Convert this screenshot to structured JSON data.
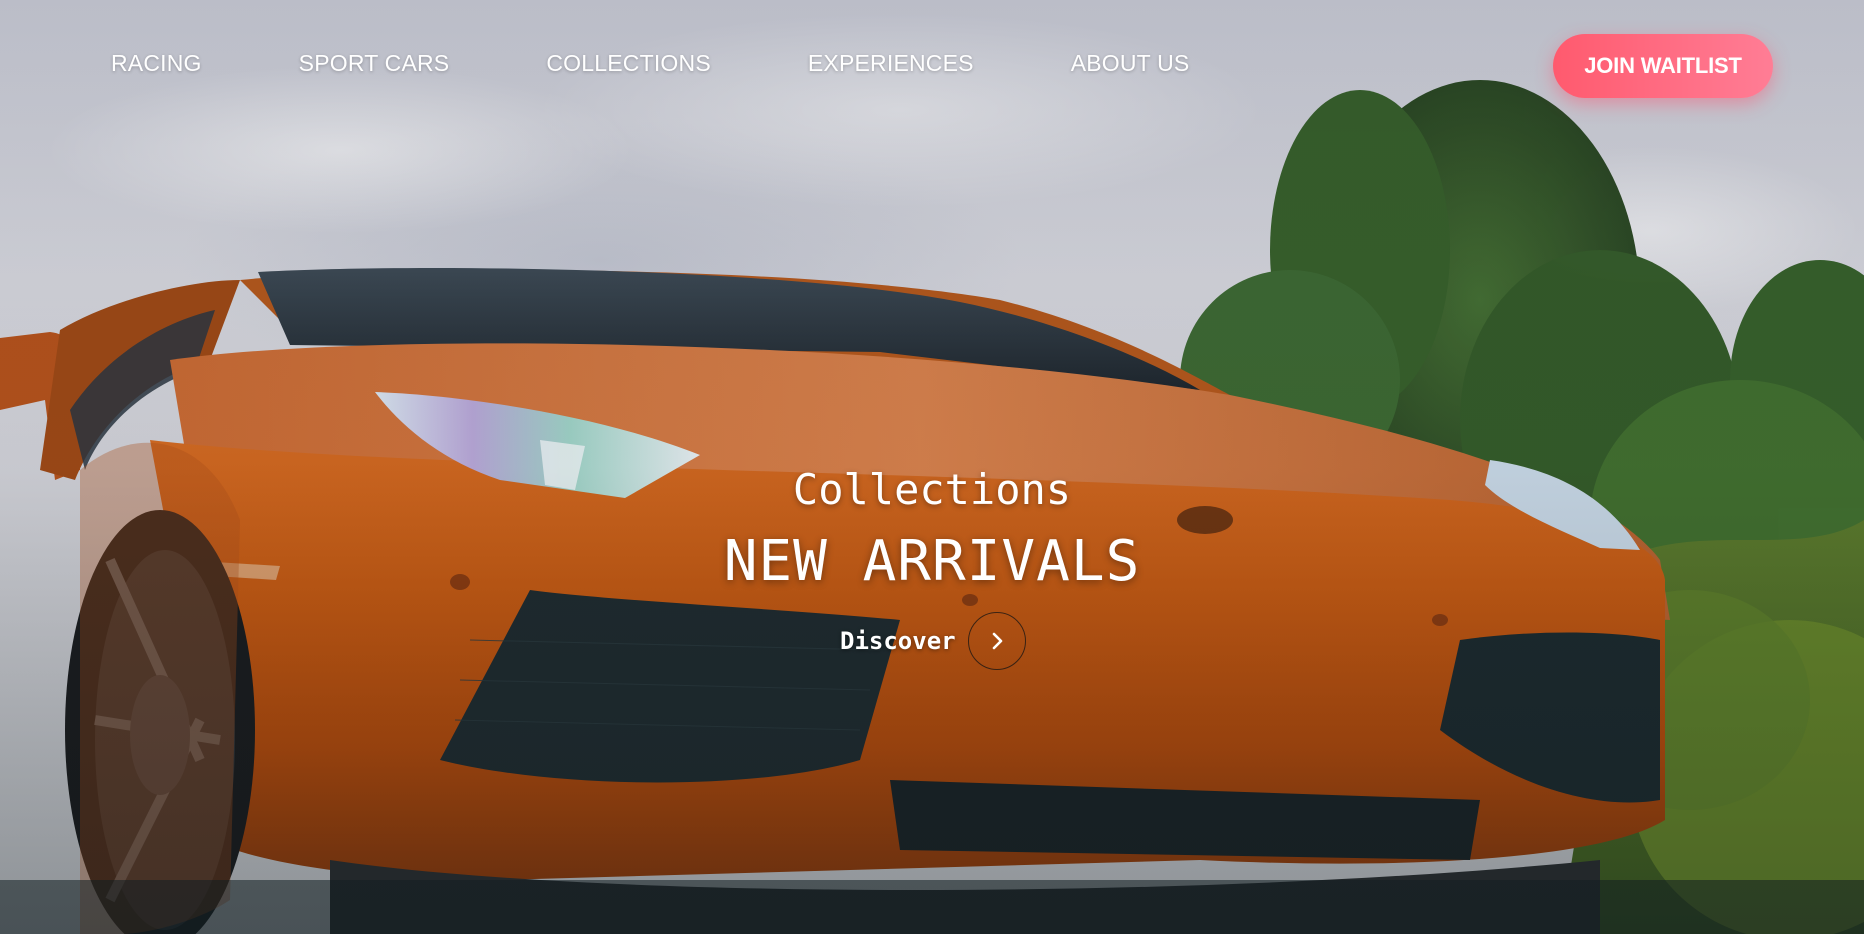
{
  "nav": {
    "items": [
      {
        "label": "RACING"
      },
      {
        "label": "SPORT CARS"
      },
      {
        "label": "COLLECTIONS"
      },
      {
        "label": "EXPERIENCES"
      },
      {
        "label": "ABOUT US"
      }
    ]
  },
  "cta": {
    "label": "JOIN WAITLIST"
  },
  "hero": {
    "subtitle": "Collections",
    "headline": "NEW ARRIVALS",
    "discover_label": "Discover",
    "discover_icon": "chevron-right-icon",
    "background_description_icon": "hero-car-photo"
  },
  "colors": {
    "cta_start": "#ff5a6e",
    "cta_end": "#ff7d95",
    "car_orange": "#c0560f",
    "text": "#ffffff"
  }
}
